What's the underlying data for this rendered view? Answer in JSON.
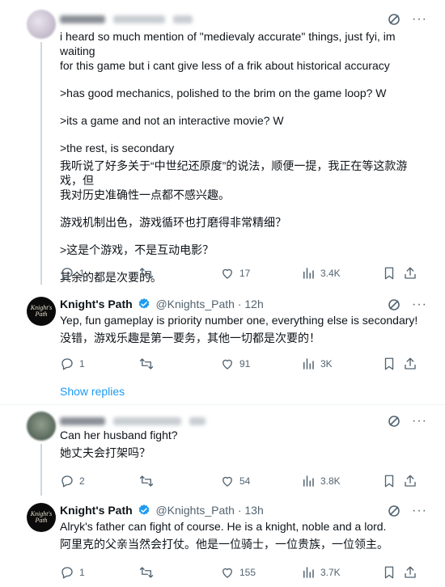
{
  "post1": {
    "name": "",
    "handle": "",
    "time": "",
    "lines": [
      "i heard so much mention of \"medievaly accurate\" things, just fyi, im waiting",
      "for this game but i cant give less of a frik about historical accuracy",
      ">has good mechanics, polished to the brim on the game loop? W",
      ">its a game and not an interactive movie? W",
      ">the rest, is secondary",
      "我听说了好多关于“中世纪还原度”的说法，顺便一提，我正在等这款游戏，但",
      "我对历史准确性一点都不感兴趣。",
      "游戏机制出色，游戏循环也打磨得非常精细？",
      ">这是个游戏，不是互动电影？",
      "其余的都是次要的。"
    ],
    "stats": {
      "replies": "1",
      "reposts": "",
      "likes": "17",
      "views": "3.4K"
    }
  },
  "post2": {
    "name": "Knight's Path",
    "handle": "@Knights_Path",
    "time": "· 12h",
    "avatar_text": "Knight's Path",
    "lines": [
      "Yep, fun gameplay is priority number one, everything else is secondary!",
      "没错，游戏乐趣是第一要务，其他一切都是次要的！"
    ],
    "stats": {
      "replies": "1",
      "reposts": "",
      "likes": "91",
      "views": "3K"
    }
  },
  "show_replies": "Show replies",
  "post3": {
    "name": "",
    "handle": "",
    "time": "",
    "lines": [
      "Can her husband fight?",
      "她丈夫会打架吗？"
    ],
    "stats": {
      "replies": "2",
      "reposts": "",
      "likes": "54",
      "views": "3.8K"
    }
  },
  "post4": {
    "name": "Knight's Path",
    "handle": "@Knights_Path",
    "time": "· 13h",
    "avatar_text": "Knight's Path",
    "lines": [
      "Alryk's father can fight of course. He is a knight, noble and a lord.",
      "阿里克的父亲当然会打仗。他是一位骑士，一位贵族，一位领主。"
    ],
    "stats": {
      "replies": "1",
      "reposts": "",
      "likes": "155",
      "views": "3.7K"
    }
  },
  "colors": {
    "accent": "#1d9bf0",
    "muted": "#536471",
    "text": "#0f1419",
    "verified": "#1d9bf0"
  },
  "icons": [
    "reply-icon",
    "repost-icon",
    "like-icon",
    "views-icon",
    "bookmark-icon",
    "share-icon",
    "grok-icon",
    "more-icon",
    "verified-icon"
  ]
}
